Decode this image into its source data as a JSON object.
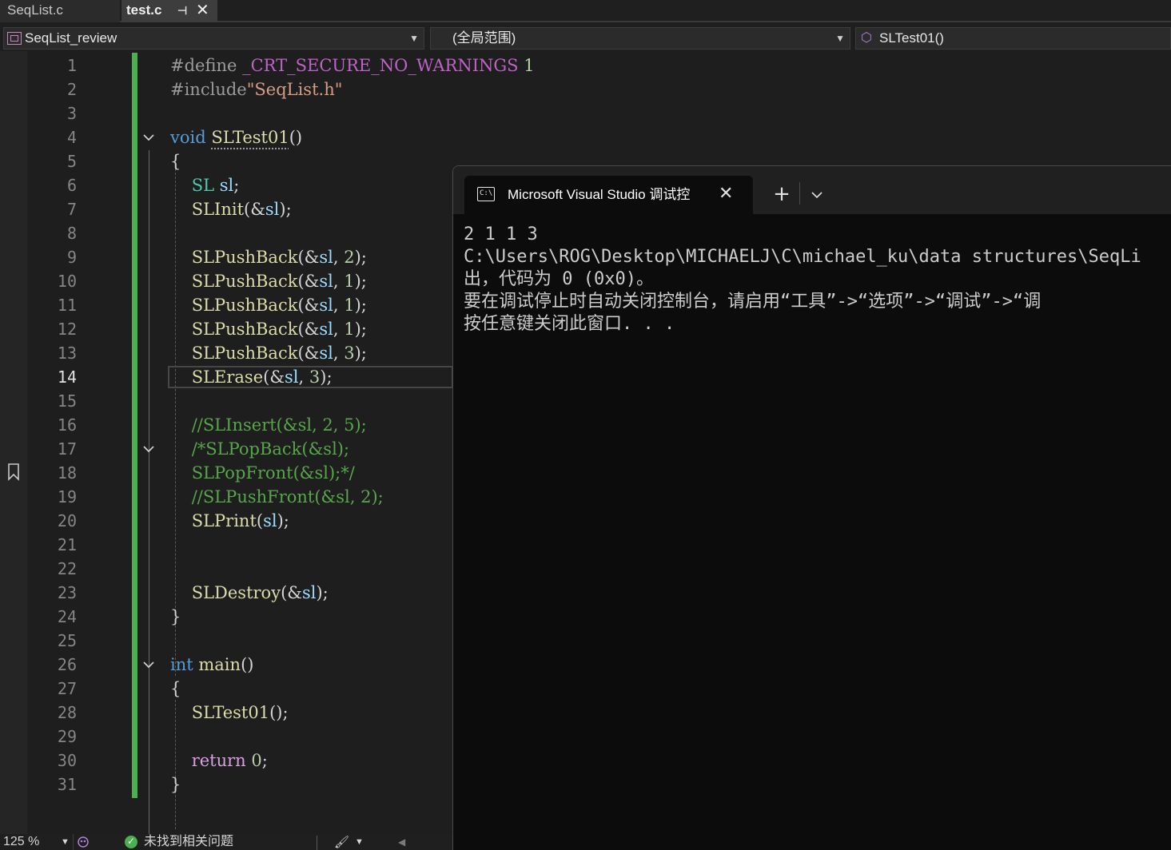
{
  "tabs": [
    {
      "label": "SeqList.c",
      "active": false
    },
    {
      "label": "test.c",
      "active": true
    }
  ],
  "navbar": {
    "project": "SeqList_review",
    "scope": "(全局范围)",
    "function": "SLTest01()"
  },
  "editor": {
    "current_line": 14,
    "line_numbers": [
      "1",
      "2",
      "3",
      "4",
      "5",
      "6",
      "7",
      "8",
      "9",
      "10",
      "11",
      "12",
      "13",
      "14",
      "15",
      "16",
      "17",
      "18",
      "19",
      "20",
      "21",
      "22",
      "23",
      "24",
      "25",
      "26",
      "27",
      "28",
      "29",
      "30",
      "31"
    ],
    "lines": [
      [
        {
          "t": "#define ",
          "c": "pp"
        },
        {
          "t": "_CRT_SECURE_NO_WARNINGS",
          "c": "mac"
        },
        {
          "t": " 1",
          "c": "num"
        }
      ],
      [
        {
          "t": "#include",
          "c": "pp"
        },
        {
          "t": "\"SeqList.h\"",
          "c": "str"
        }
      ],
      [],
      [
        {
          "t": "void",
          "c": "kw"
        },
        {
          "t": " ",
          "c": "pn"
        },
        {
          "t": "SLTest01",
          "c": "fn squiggle"
        },
        {
          "t": "()",
          "c": "pn"
        }
      ],
      [
        {
          "t": "{",
          "c": "pn"
        }
      ],
      [
        {
          "t": "    SL",
          "c": "ty"
        },
        {
          "t": " sl",
          "c": "var"
        },
        {
          "t": ";",
          "c": "pn"
        }
      ],
      [
        {
          "t": "    SLInit",
          "c": "fn"
        },
        {
          "t": "(&",
          "c": "pn"
        },
        {
          "t": "sl",
          "c": "var"
        },
        {
          "t": ");",
          "c": "pn"
        }
      ],
      [],
      [
        {
          "t": "    SLPushBack",
          "c": "fn"
        },
        {
          "t": "(&",
          "c": "pn"
        },
        {
          "t": "sl",
          "c": "var"
        },
        {
          "t": ", ",
          "c": "pn"
        },
        {
          "t": "2",
          "c": "num"
        },
        {
          "t": ");",
          "c": "pn"
        }
      ],
      [
        {
          "t": "    SLPushBack",
          "c": "fn"
        },
        {
          "t": "(&",
          "c": "pn"
        },
        {
          "t": "sl",
          "c": "var"
        },
        {
          "t": ", ",
          "c": "pn"
        },
        {
          "t": "1",
          "c": "num"
        },
        {
          "t": ");",
          "c": "pn"
        }
      ],
      [
        {
          "t": "    SLPushBack",
          "c": "fn"
        },
        {
          "t": "(&",
          "c": "pn"
        },
        {
          "t": "sl",
          "c": "var"
        },
        {
          "t": ", ",
          "c": "pn"
        },
        {
          "t": "1",
          "c": "num"
        },
        {
          "t": ");",
          "c": "pn"
        }
      ],
      [
        {
          "t": "    SLPushBack",
          "c": "fn"
        },
        {
          "t": "(&",
          "c": "pn"
        },
        {
          "t": "sl",
          "c": "var"
        },
        {
          "t": ", ",
          "c": "pn"
        },
        {
          "t": "1",
          "c": "num"
        },
        {
          "t": ");",
          "c": "pn"
        }
      ],
      [
        {
          "t": "    SLPushBack",
          "c": "fn"
        },
        {
          "t": "(&",
          "c": "pn"
        },
        {
          "t": "sl",
          "c": "var"
        },
        {
          "t": ", ",
          "c": "pn"
        },
        {
          "t": "3",
          "c": "num"
        },
        {
          "t": ");",
          "c": "pn"
        }
      ],
      [
        {
          "t": "    SLErase",
          "c": "fn"
        },
        {
          "t": "(&",
          "c": "pn"
        },
        {
          "t": "sl",
          "c": "var"
        },
        {
          "t": ", ",
          "c": "pn"
        },
        {
          "t": "3",
          "c": "num"
        },
        {
          "t": ");",
          "c": "pn"
        }
      ],
      [],
      [
        {
          "t": "    //SLInsert(&sl, 2, 5);",
          "c": "cm"
        }
      ],
      [
        {
          "t": "    /*SLPopBack(&sl);",
          "c": "cm"
        }
      ],
      [
        {
          "t": "    SLPopFront(&sl);*/",
          "c": "cm"
        }
      ],
      [
        {
          "t": "    //SLPushFront(&sl, 2);",
          "c": "cm"
        }
      ],
      [
        {
          "t": "    SLPrint",
          "c": "fn"
        },
        {
          "t": "(",
          "c": "pn"
        },
        {
          "t": "sl",
          "c": "var"
        },
        {
          "t": ");",
          "c": "pn"
        }
      ],
      [],
      [],
      [
        {
          "t": "    SLDestroy",
          "c": "fn"
        },
        {
          "t": "(&",
          "c": "pn"
        },
        {
          "t": "sl",
          "c": "var"
        },
        {
          "t": ");",
          "c": "pn"
        }
      ],
      [
        {
          "t": "}",
          "c": "pn"
        }
      ],
      [],
      [
        {
          "t": "int",
          "c": "kw"
        },
        {
          "t": " ",
          "c": "pn"
        },
        {
          "t": "main",
          "c": "fn"
        },
        {
          "t": "()",
          "c": "pn"
        }
      ],
      [
        {
          "t": "{",
          "c": "pn"
        }
      ],
      [
        {
          "t": "    SLTest01",
          "c": "fn"
        },
        {
          "t": "();",
          "c": "pn"
        }
      ],
      [],
      [
        {
          "t": "    return",
          "c": "ret"
        },
        {
          "t": " ",
          "c": "pn"
        },
        {
          "t": "0",
          "c": "num"
        },
        {
          "t": ";",
          "c": "pn"
        }
      ],
      [
        {
          "t": "}",
          "c": "pn"
        }
      ]
    ],
    "fold_lines": [
      4,
      17,
      26
    ]
  },
  "statusbar": {
    "zoom": "125 %",
    "issues": "未找到相关问题"
  },
  "console": {
    "title": "Microsoft Visual Studio 调试控",
    "output": [
      "2 1 1 3",
      "C:\\Users\\ROG\\Desktop\\MICHAELJ\\C\\michael_ku\\data structures\\SeqLi",
      "出，代码为 0 (0x0)。",
      "要在调试停止时自动关闭控制台，请启用“工具”->“选项”->“调试”->“调",
      "按任意键关闭此窗口. . ."
    ]
  },
  "colors": {
    "change_bar": "#4caf50",
    "keyword": "#569cd6",
    "function": "#dcdcaa",
    "comment": "#57a64a",
    "console_bg": "#0c0c0c"
  }
}
